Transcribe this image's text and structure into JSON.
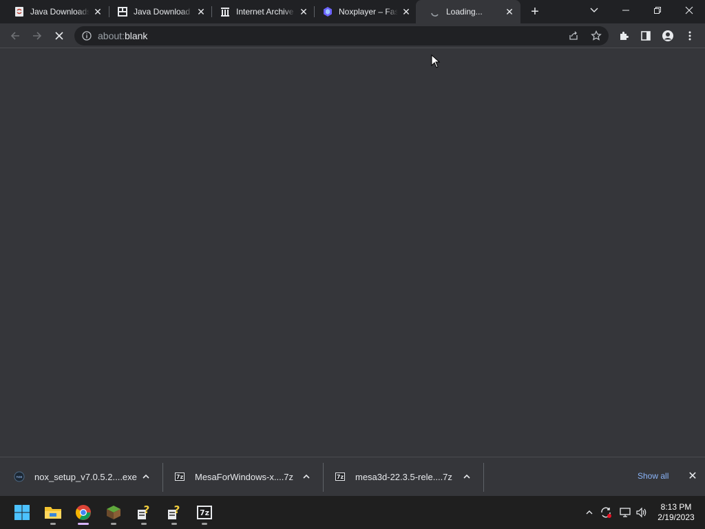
{
  "tabs": [
    {
      "title": "Java Downloads"
    },
    {
      "title": "Java Download |"
    },
    {
      "title": "Internet Archive"
    },
    {
      "title": "Noxplayer – Fast"
    },
    {
      "title": "Loading..."
    }
  ],
  "address": {
    "scheme": "about:",
    "path": "blank"
  },
  "downloads": [
    {
      "name": "nox_setup_v7.0.5.2....exe",
      "icon": "nox-icon"
    },
    {
      "name": "MesaForWindows-x....7z",
      "icon": "7z-archive-icon"
    },
    {
      "name": "mesa3d-22.3.5-rele....7z",
      "icon": "7z-archive-icon"
    }
  ],
  "download_bar": {
    "show_all": "Show all"
  },
  "clock": {
    "time": "8:13 PM",
    "date": "2/19/2023"
  },
  "colors": {
    "accent": "#8ab4f8",
    "chrome_dark": "#202124",
    "surface": "#35363a"
  }
}
